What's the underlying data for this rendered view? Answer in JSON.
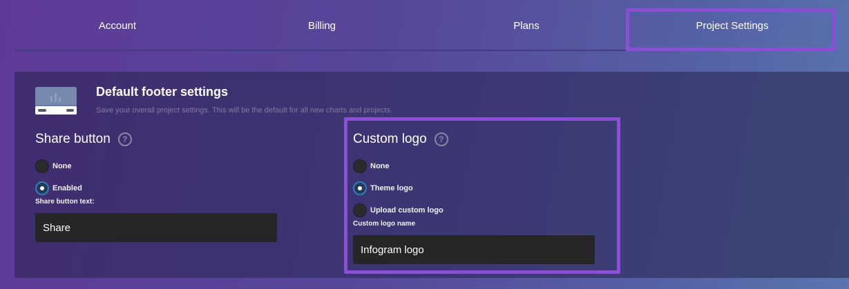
{
  "tabs": [
    {
      "label": "Account"
    },
    {
      "label": "Billing"
    },
    {
      "label": "Plans"
    },
    {
      "label": "Project Settings"
    }
  ],
  "panel": {
    "title": "Default footer settings",
    "subtitle": "Save your overall project settings. This will be the default for all new charts and projects."
  },
  "share": {
    "heading": "Share button",
    "help": "?",
    "options": [
      {
        "label": "None",
        "checked": false
      },
      {
        "label": "Enabled",
        "checked": true
      }
    ],
    "text_label": "Share button text:",
    "text_value": "Share"
  },
  "logo": {
    "heading": "Custom logo",
    "help": "?",
    "options": [
      {
        "label": "None",
        "checked": false
      },
      {
        "label": "Theme logo",
        "checked": true
      },
      {
        "label": "Upload custom logo",
        "checked": false
      }
    ],
    "name_label": "Custom logo name",
    "name_value": "Infogram logo"
  },
  "colors": {
    "highlight": "#8b4fd4",
    "radio_checked": "#2f7fc0",
    "input_bg": "#262628"
  }
}
